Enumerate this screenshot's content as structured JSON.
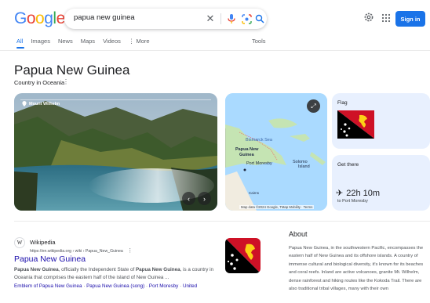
{
  "header": {
    "logo_letters": [
      "G",
      "o",
      "o",
      "g",
      "l",
      "e"
    ],
    "query": "papua new guinea",
    "signin_label": "Sign in",
    "colors": {
      "accent": "#1a73e8",
      "link": "#1a0dab"
    }
  },
  "tabs": [
    {
      "label": "All",
      "active": true
    },
    {
      "label": "Images"
    },
    {
      "label": "News"
    },
    {
      "label": "Maps"
    },
    {
      "label": "Videos"
    },
    {
      "label": "⋮ More"
    }
  ],
  "tools_label": "Tools",
  "entity": {
    "title": "Papua New Guinea",
    "subtitle": "Country in Oceania"
  },
  "photo": {
    "label": "Mount Wilhelm"
  },
  "map": {
    "labels": {
      "bismarck": "Bismarck Sea",
      "png_line1": "Papua New",
      "png_line2": "Guinea",
      "port_moresby": "Port Moresby",
      "solomon_line1": "Solomo",
      "solomon_line2": "Island",
      "cairns": "Cairns"
    },
    "attribution": "Map data ©2024 Google, TMap Mobility · Terms"
  },
  "cards": {
    "flag_title": "Flag",
    "getthere_title": "Get there",
    "travel_time": "22h 10m",
    "destination": "to Port Moresby"
  },
  "result": {
    "site_name": "Wikipedia",
    "url": "https://en.wikipedia.org › wiki › Papua_New_Guinea",
    "title": "Papua New Guinea",
    "snippet_prefix_bold": "Papua New Guinea",
    "snippet_mid": ", officially the Independent State of ",
    "snippet_bold2": "Papua New Guinea",
    "snippet_rest": ", is a country in Oceania that comprises the eastern half of the island of New Guinea ...",
    "links": [
      "Emblem of Papua New Guinea",
      "Papua New Guinea (song)",
      "Port Moresby",
      "United"
    ]
  },
  "about": {
    "title": "About",
    "text": "Papua New Guinea, in the southwestern Pacific, encompasses the eastern half of New Guinea and its offshore islands. A country of immense cultural and biological diversity, it's known for its beaches and coral reefs. Inland are active volcanoes, granite Mt. Wilhelm, dense rainforest and hiking routes like the Kokoda Trail. There are also traditional tribal villages, many with their own"
  }
}
